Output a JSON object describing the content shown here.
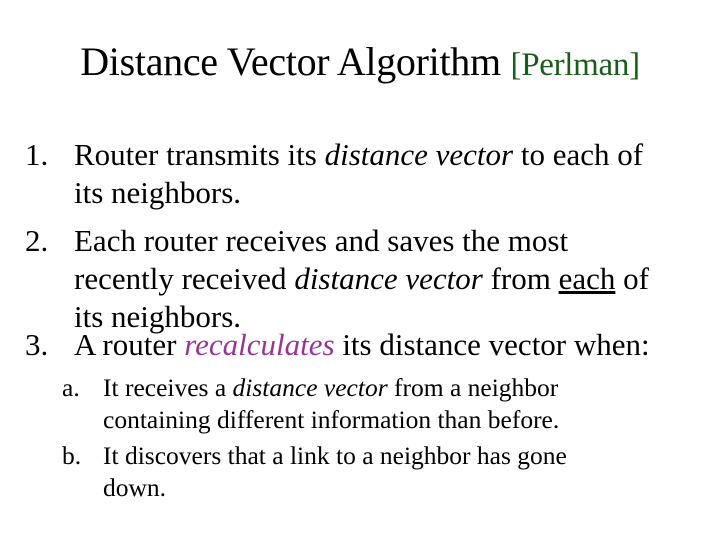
{
  "slide": {
    "title": {
      "main": "Distance Vector Algorithm",
      "citation": "[Perlman]"
    },
    "colors": {
      "text": "#000000",
      "citation": "#1a5c1a",
      "highlight": "#993399",
      "background": "#ffffff"
    },
    "items": [
      {
        "number": "1.",
        "lines": [
          {
            "pre": "Router transmits its ",
            "em": "distance vector",
            "post": " to each of"
          },
          {
            "text": "its neighbors."
          }
        ]
      },
      {
        "number": "2.",
        "lines": [
          {
            "text": "Each router receives and saves the most"
          },
          {
            "pre": "recently received ",
            "em": "distance vector",
            "mid": " from ",
            "underline": "each",
            "post": " of"
          },
          {
            "text": "its neighbors."
          }
        ]
      },
      {
        "number": "3.",
        "lines": [
          {
            "pre": "A router ",
            "highlight": "recalculates",
            "post": " its distance vector when:"
          }
        ],
        "subitems": [
          {
            "letter": "a.",
            "lines": [
              {
                "pre": "It receives a ",
                "em": "distance vector",
                "post": " from a neighbor"
              },
              {
                "text": "containing different information than before."
              }
            ]
          },
          {
            "letter": "b.",
            "lines": [
              {
                "text": "It discovers that a link to a neighbor has gone"
              },
              {
                "text": "down."
              }
            ]
          }
        ]
      }
    ]
  }
}
